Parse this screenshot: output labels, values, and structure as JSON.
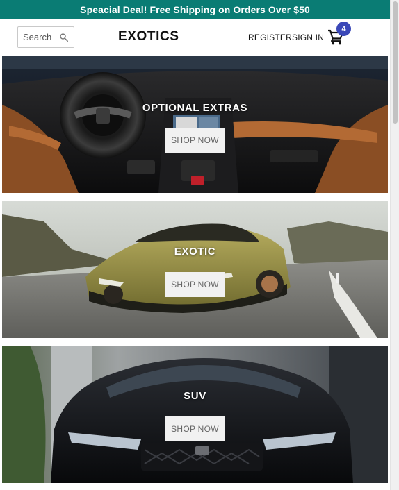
{
  "announcement": {
    "text": "Speacial Deal! Free Shipping on Orders Over $50"
  },
  "header": {
    "search": {
      "placeholder": "Search",
      "icon": "search-icon"
    },
    "logo": "EXOTICS",
    "nav": {
      "register": "REGISTER",
      "sign_in": "SIGN IN"
    },
    "cart": {
      "icon": "shopping-cart-icon",
      "count": "4"
    }
  },
  "banners": [
    {
      "title": "OPTIONAL EXTRAS",
      "button": "SHOP NOW"
    },
    {
      "title": "EXOTIC",
      "button": "SHOP NOW"
    },
    {
      "title": "SUV",
      "button": "SHOP NOW"
    }
  ],
  "colors": {
    "announcement_bg": "#0a7c74",
    "cart_badge": "#3b48b8",
    "button_bg": "#f1f1f1"
  }
}
